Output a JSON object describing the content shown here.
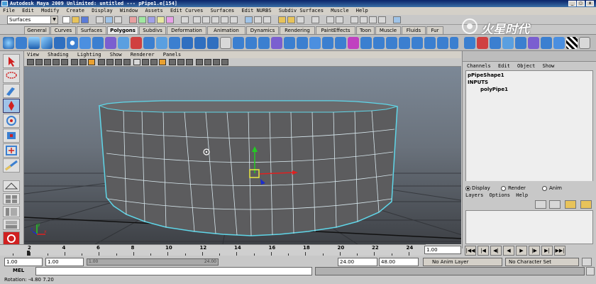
{
  "window": {
    "title": "Autodesk Maya 2009 Unlimited: untitled   ---   pPipe1.e[154]",
    "controls": [
      "_",
      "□",
      "x"
    ]
  },
  "menubar": [
    "File",
    "Edit",
    "Modify",
    "Create",
    "Display",
    "Window",
    "Assets",
    "Edit Curves",
    "Surfaces",
    "Edit NURBS",
    "Subdiv Surfaces",
    "Muscle",
    "Help"
  ],
  "status_line": {
    "mode": "Surfaces"
  },
  "shelf_tabs": [
    "General",
    "Curves",
    "Surfaces",
    "Polygons",
    "Subdivs",
    "Deformation",
    "Animation",
    "Dynamics",
    "Rendering",
    "PaintEffects",
    "Toon",
    "Muscle",
    "Fluids",
    "Fur"
  ],
  "shelf_active_tab": "Polygons",
  "viewport": {
    "menu": [
      "View",
      "Shading",
      "Lighting",
      "Show",
      "Renderer",
      "Panels"
    ]
  },
  "channel_box": {
    "menu": [
      "Channels",
      "Edit",
      "Object",
      "Show"
    ],
    "object": "pPipeShape1",
    "inputs_label": "INPUTS",
    "input_node": "polyPipe1"
  },
  "layer_editor": {
    "modes": [
      "Display",
      "Render",
      "Anim"
    ],
    "selected_mode": "Display",
    "menu": [
      "Layers",
      "Options",
      "Help"
    ]
  },
  "time_slider": {
    "ticks": [
      "2",
      "4",
      "6",
      "8",
      "10",
      "12",
      "14",
      "16",
      "18",
      "20",
      "22",
      "24"
    ],
    "current_time": "1.00"
  },
  "range_slider": {
    "start_time": "1.00",
    "playback_start": "1.00",
    "range_label_start": "1.00",
    "range_label_end": "24.00",
    "playback_end": "24.00",
    "end_time": "48.00",
    "anim_layer": "No Anim Layer",
    "character_set": "No Character Set"
  },
  "command_line": {
    "label": "MEL"
  },
  "help_line": {
    "text": "Rotation: -4.80     7.20"
  },
  "watermark": "火星时代",
  "colors": {
    "wireframe": "#5fd6e8",
    "manip_y": "#22cc22",
    "manip_x": "#e02020",
    "manip_z": "#1a2bd0"
  }
}
